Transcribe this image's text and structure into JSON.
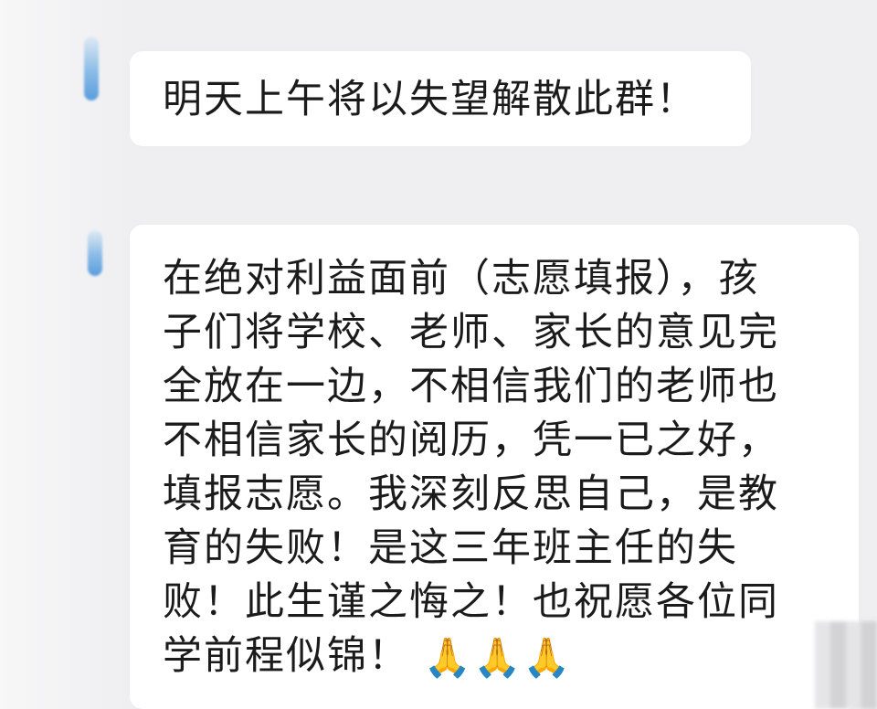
{
  "chat": {
    "messages": [
      {
        "text": "明天上午将以失望解散此群！"
      },
      {
        "text": "在绝对利益面前（志愿填报），孩\n子们将学校、老师、家长的意见完\n全放在一边，不相信我们的老师也\n不相信家长的阅历，凭一已之好，\n填报志愿。我深刻反思自己，是教\n育的失败！是这三年班主任的失\n败！此生谨之悔之！也祝愿各位同\n学前程似锦！",
        "emoji": "🙏🙏🙏"
      }
    ]
  },
  "colors": {
    "background": "#efeff1",
    "bubble": "#ffffff",
    "text": "#1b1b1b",
    "avatar_accent": "#4a95da"
  },
  "icons": {
    "avatar": "avatar-icon",
    "emoji": "praying-hands-icon"
  }
}
